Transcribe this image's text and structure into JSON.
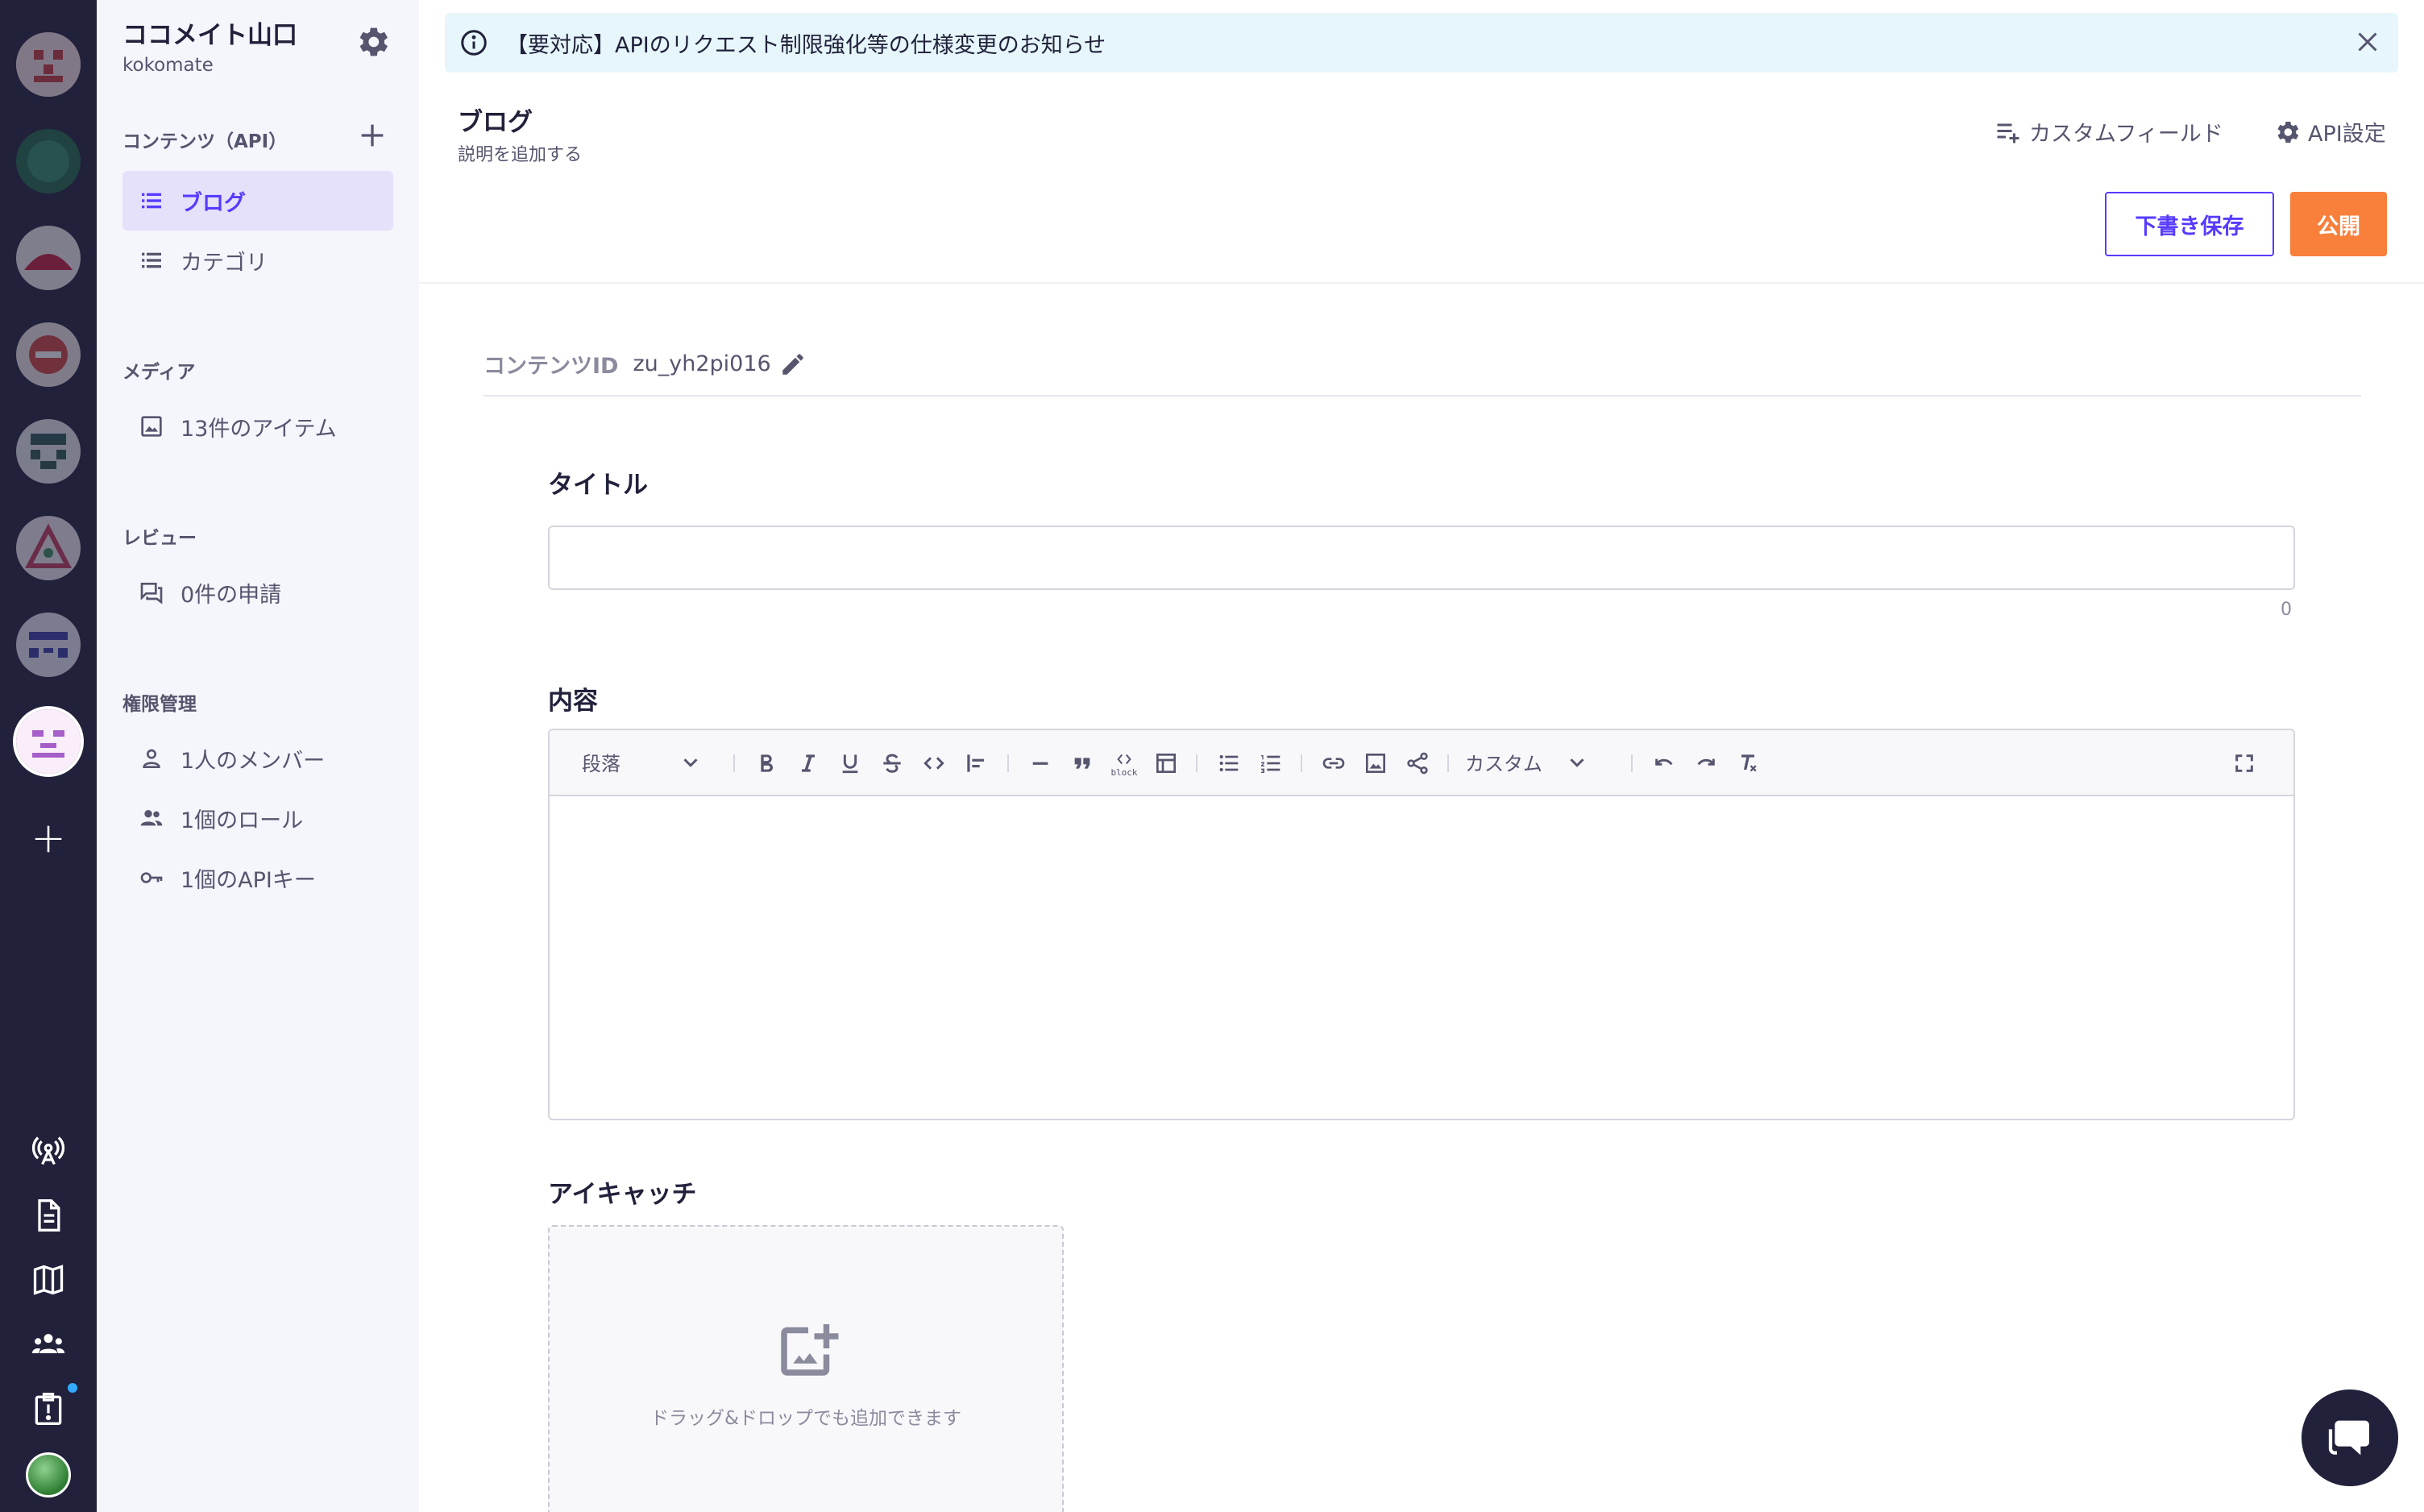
{
  "service": {
    "name": "ココメイト山口",
    "id": "kokomate"
  },
  "sidebar": {
    "contents_title": "コンテンツ（API）",
    "contents": [
      {
        "label": "ブログ",
        "active": true
      },
      {
        "label": "カテゴリ",
        "active": false
      }
    ],
    "media_title": "メディア",
    "media_item": "13件のアイテム",
    "review_title": "レビュー",
    "review_item": "0件の申請",
    "perm_title": "権限管理",
    "perm_items": [
      "1人のメンバー",
      "1個のロール",
      "1個のAPIキー"
    ]
  },
  "banner": {
    "text": "【要対応】APIのリクエスト制限強化等の仕様変更のお知らせ"
  },
  "header": {
    "title": "ブログ",
    "description": "説明を追加する",
    "custom_field": "カスタムフィールド",
    "api_settings": "API設定",
    "draft_button": "下書き保存",
    "publish_button": "公開"
  },
  "content_id": {
    "label": "コンテンツID",
    "value": "zu_yh2pi016"
  },
  "fields": {
    "title_label": "タイトル",
    "title_value": "",
    "title_count": "0",
    "content_label": "内容",
    "eyecatch_label": "アイキャッチ",
    "dropzone_text": "ドラッグ&ドロップでも追加できます"
  },
  "toolbar": {
    "paragraph": "段落",
    "custom": "カスタム",
    "block_caption": "block"
  },
  "colors": {
    "rail": "#21213b",
    "accent": "#563bff",
    "publish": "#f8803b",
    "banner": "#e6f6fa"
  }
}
